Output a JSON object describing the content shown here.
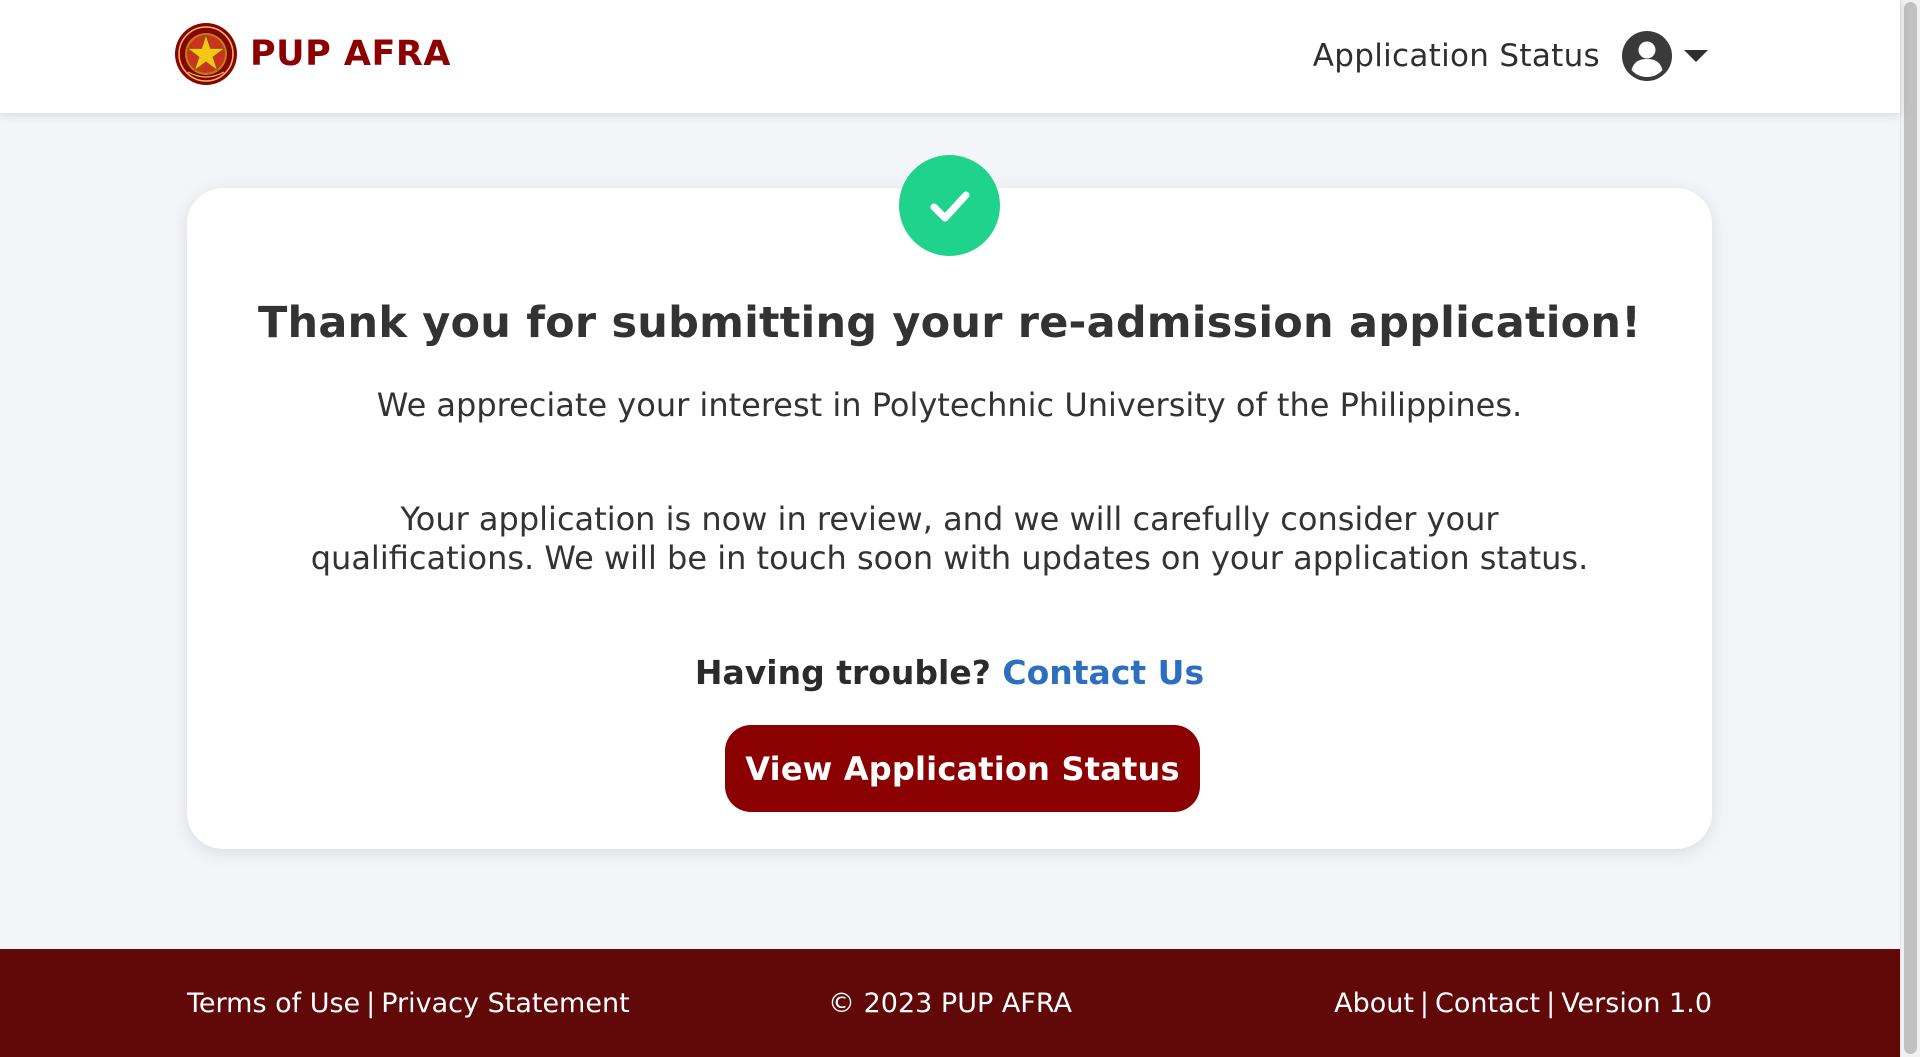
{
  "header": {
    "brand_name": "PUP AFRA",
    "nav_link": "Application Status",
    "user_menu_icon": "user-circle-icon",
    "caret_icon": "chevron-down-icon",
    "brand_color": "#8b0000"
  },
  "card": {
    "status_icon": "check-circle-icon",
    "status_color": "#1fd38d",
    "title": "Thank you for submitting your re-admission application!",
    "paragraph_1": "We appreciate your interest in Polytechnic University of the Philippines.",
    "paragraph_2": "Your application is now in review, and we will carefully consider your qualifications. We will be in touch soon with updates on your application status.",
    "trouble_text": "Having trouble?",
    "contact_link": "Contact Us",
    "contact_link_color": "#2c6fbf",
    "cta_label": "View Application Status"
  },
  "footer": {
    "terms": "Terms of Use",
    "privacy": "Privacy Statement",
    "copyright": "© 2023 PUP AFRA",
    "about": "About",
    "contact": "Contact",
    "version": "Version 1.0",
    "separator": "|",
    "background_color": "#610909"
  }
}
